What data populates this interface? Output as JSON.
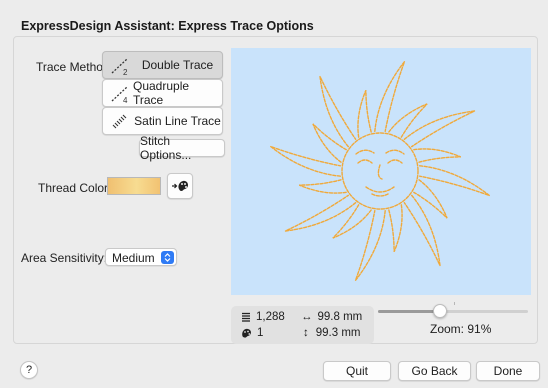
{
  "window": {
    "title": "ExpressDesign Assistant: Express Trace Options"
  },
  "trace": {
    "label": "Trace Method:",
    "options": [
      {
        "label": "Double Trace",
        "icon": "double-trace-icon",
        "selected": true
      },
      {
        "label": "Quadruple Trace",
        "icon": "quadruple-trace-icon",
        "selected": false
      },
      {
        "label": "Satin Line Trace",
        "icon": "satin-line-trace-icon",
        "selected": false
      }
    ],
    "stitch_options_label": "Stitch Options..."
  },
  "thread": {
    "label": "Thread Color:",
    "color": "#f3c878",
    "button_icon": "thread-color-picker-icon"
  },
  "area": {
    "label": "Area Sensitivity:",
    "value": "Medium"
  },
  "preview": {
    "background": "#c9e3fb",
    "stitch_color": "#f0a93a"
  },
  "stats": {
    "stitches": "1,288",
    "colors": "1",
    "width": "99.8 mm",
    "height": "99.3 mm"
  },
  "zoom": {
    "label": "Zoom: 91%",
    "slider_fraction": 0.41
  },
  "footer": {
    "help": "?",
    "quit": "Quit",
    "go_back": "Go Back",
    "done": "Done"
  }
}
